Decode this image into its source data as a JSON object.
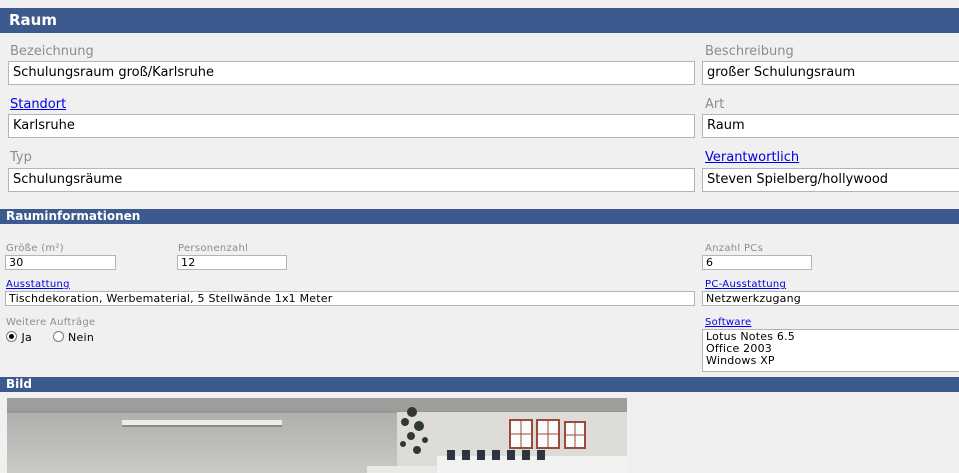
{
  "section_title": "Raum",
  "fields": {
    "bezeichnung": {
      "label": "Bezeichnung",
      "value": "Schulungsraum groß/Karlsruhe"
    },
    "beschreibung": {
      "label": "Beschreibung",
      "value": "großer Schulungsraum"
    },
    "standort": {
      "label": "Standort",
      "value": "Karlsruhe"
    },
    "art": {
      "label": "Art",
      "value": "Raum"
    },
    "typ": {
      "label": "Typ",
      "value": "Schulungsräume"
    },
    "verantwortlich": {
      "label": "Verantwortlich",
      "value": "Steven Spielberg/hollywood"
    }
  },
  "rauminfo": {
    "title": "Rauminformationen",
    "groesse": {
      "label": "Größe (m²)",
      "value": "30"
    },
    "personenzahl": {
      "label": "Personenzahl",
      "value": "12"
    },
    "anzahl_pcs": {
      "label": "Anzahl PCs",
      "value": "6"
    },
    "ausstattung": {
      "label": "Ausstattung",
      "value": "Tischdekoration, Werbematerial, 5 Stellwände 1x1 Meter"
    },
    "pc_ausstattung": {
      "label": "PC-Ausstattung",
      "value": "Netzwerkzugang"
    },
    "weitere_auftraege": {
      "label": "Weitere Aufträge",
      "options": [
        "Ja",
        "Nein"
      ],
      "selected": "Ja"
    },
    "software": {
      "label": "Software",
      "items": [
        "Lotus Notes 6.5",
        "Office 2003",
        "Windows XP"
      ]
    }
  },
  "bild": {
    "title": "Bild"
  },
  "colors": {
    "header_bg": "#3c5a8e",
    "page_bg": "#f1f0f0",
    "link": "#0000e6",
    "label": "#8d8d8d"
  }
}
